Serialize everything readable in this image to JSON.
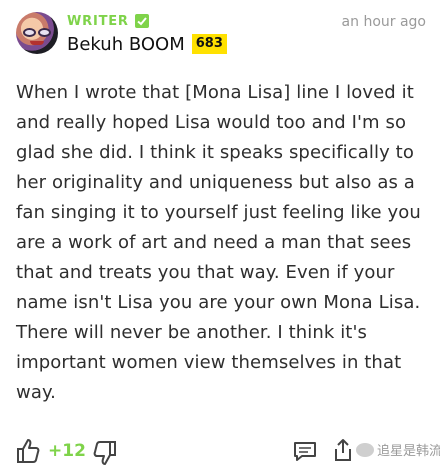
{
  "annotation": {
    "role": "WRITER",
    "author": "Bekuh BOOM",
    "iq": "683",
    "timestamp": "an hour ago",
    "body": "When I wrote that [Mona Lisa] line I loved it and really hoped Lisa would too and I'm so glad she did. I think it speaks specifically to her originality and uniqueness but also as a fan singing it to yourself just feeling like you are a work of art and need a man that sees that and treats you that way. Even if your name isn't Lisa you are your own Mona Lisa. There will never be another. I think it's important women view themselves in that way."
  },
  "footer": {
    "votes": "+12",
    "watermark": "追星是韩流"
  },
  "colors": {
    "accent_green": "#7fd34a",
    "iq_badge": "#ffe100"
  },
  "icons": [
    "verified-check-icon",
    "thumbs-up-icon",
    "thumbs-down-icon",
    "comment-icon",
    "share-icon"
  ]
}
